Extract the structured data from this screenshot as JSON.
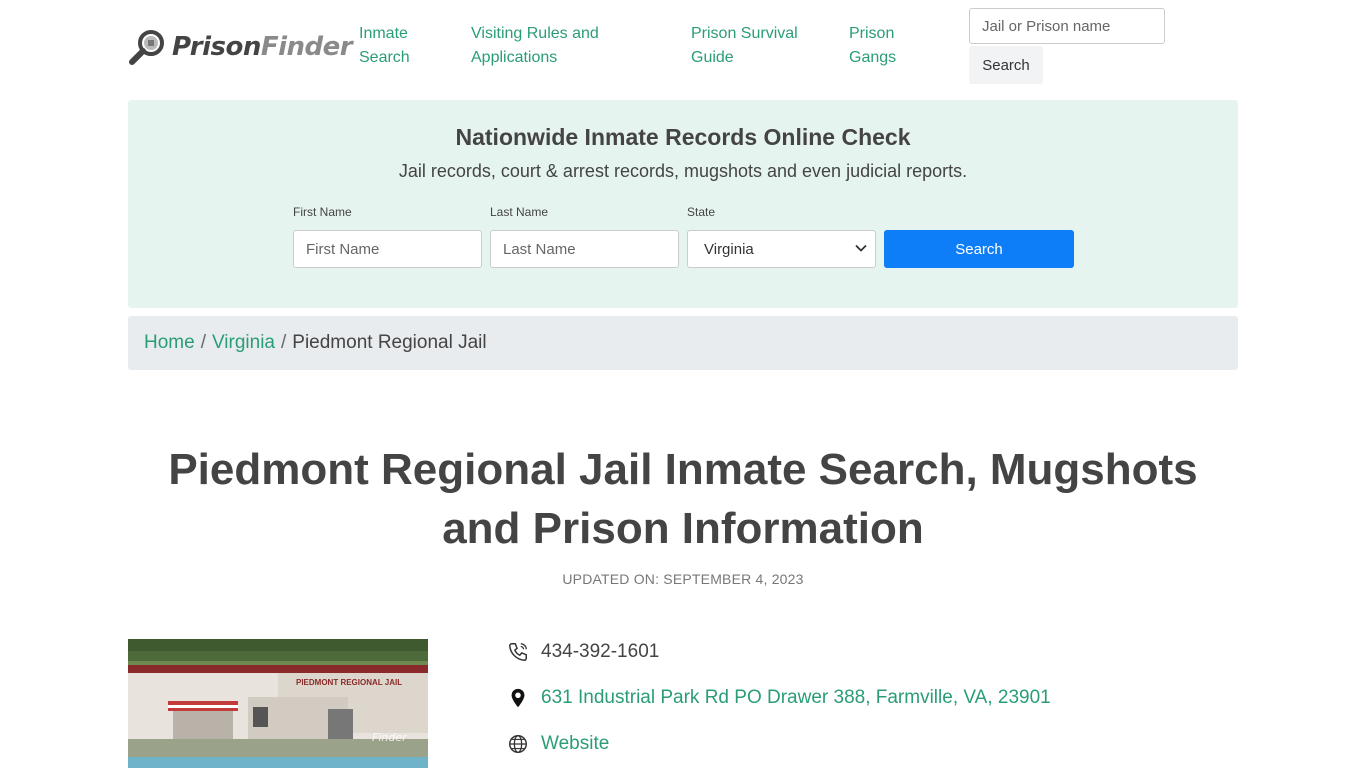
{
  "header": {
    "logo_part1": "Prison",
    "logo_part2": "Finder",
    "nav": [
      {
        "label": "Inmate Search"
      },
      {
        "label": "Visiting Rules and Applications"
      },
      {
        "label": "Prison Survival Guide"
      },
      {
        "label": "Prison Gangs"
      }
    ],
    "search_placeholder": "Jail or Prison name",
    "search_button": "Search"
  },
  "promo": {
    "title": "Nationwide Inmate Records Online Check",
    "subtitle": "Jail records, court & arrest records, mugshots and even judicial reports.",
    "first_name_label": "First Name",
    "first_name_placeholder": "First Name",
    "last_name_label": "Last Name",
    "last_name_placeholder": "Last Name",
    "state_label": "State",
    "state_value": "Virginia",
    "search_button": "Search"
  },
  "breadcrumb": {
    "home": "Home",
    "sep": "/",
    "state": "Virginia",
    "current": "Piedmont Regional Jail"
  },
  "page": {
    "title": "Piedmont Regional Jail Inmate Search, Mugshots and Prison Information",
    "updated": "UPDATED ON: SEPTEMBER 4, 2023"
  },
  "photo": {
    "sign_text": "PIEDMONT REGIONAL JAIL",
    "watermark": "Finder"
  },
  "contact": {
    "phone": "434-392-1601",
    "address": "631 Industrial Park Rd PO Drawer 388, Farmville, VA, 23901",
    "website_label": "Website"
  },
  "colors": {
    "accent": "#2a9d78",
    "primary_button": "#0d7df8",
    "promo_bg": "#e6f4f0",
    "breadcrumb_bg": "#e9ecee"
  }
}
